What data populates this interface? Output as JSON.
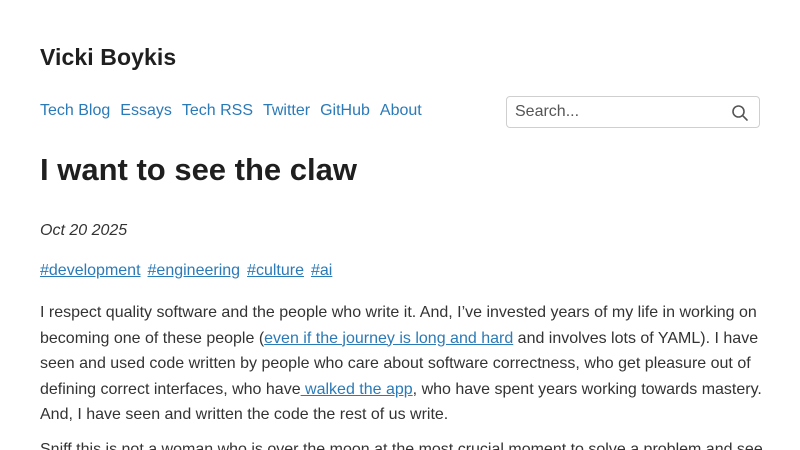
{
  "site": {
    "title_prefix": "",
    "title": "Vicki Boykis",
    "title_suffix": ""
  },
  "nav": {
    "items": [
      {
        "label": "Tech Blog"
      },
      {
        "label": "Essays"
      },
      {
        "label": "Tech RSS"
      },
      {
        "label": "Twitter"
      },
      {
        "label": "GitHub"
      },
      {
        "label": "About"
      }
    ]
  },
  "search": {
    "placeholder": "Search...",
    "icon": "search-icon"
  },
  "post": {
    "title": "I want to see the claw",
    "date": "Oct 20 2025",
    "tags": [
      "#development",
      "#engineering",
      "#culture",
      "#ai"
    ],
    "paragraph1": {
      "t1": "I respect quality software and the people who write it. And, I’ve invested years of my life in working on becoming one of these people (",
      "link1": "even if the journey is long and hard",
      "t2": " and involves lots of YAML). I have seen and used code written by people who care about software correctness, who get pleasure out of defining correct interfaces, who have",
      "link2": " walked the app",
      "t3": ", who have spent years working towards mastery. And, I have seen and written the code the rest of us write."
    },
    "paragraph2": {
      "text": "Sniff this is not a woman who is over the moon at the most crucial moment to solve a problem and see"
    }
  },
  "colors": {
    "link": "#2a7ab8",
    "text": "#333333",
    "heading": "#1f1f1f"
  }
}
